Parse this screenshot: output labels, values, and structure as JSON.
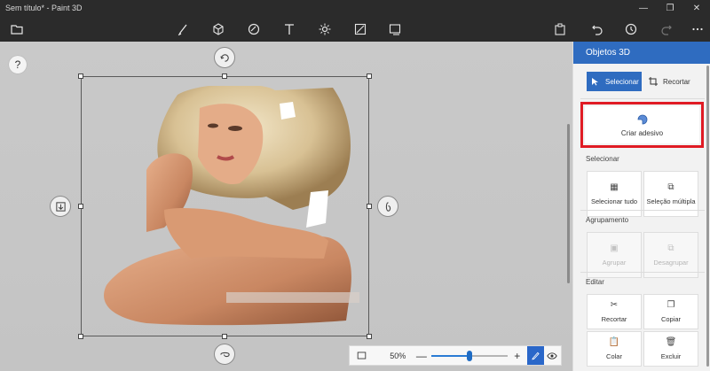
{
  "window": {
    "title": "Sem título* - Paint 3D"
  },
  "window_controls": {
    "minimize": "—",
    "maximize": "❐",
    "close": "✕"
  },
  "toolbar": {
    "tools": [
      "menu-icon",
      "brushes-icon",
      "3d-shapes-icon",
      "stickers-icon",
      "text-icon",
      "effects-icon",
      "canvas-icon",
      "3d-library-icon"
    ],
    "right": [
      "paste-icon",
      "undo-icon",
      "history-icon",
      "redo-icon",
      "more-icon"
    ]
  },
  "canvas": {
    "help_label": "?"
  },
  "zoom": {
    "percent_label": "50%",
    "minus_label": "—",
    "plus_label": "+",
    "level": 0.5
  },
  "panel": {
    "title": "Objetos 3D",
    "select_label": "Selecionar",
    "crop_label": "Recortar",
    "sticker_label": "Criar adesivo",
    "sections": {
      "select": {
        "label": "Selecionar",
        "all_label": "Selecionar tudo",
        "multi_label": "Seleção múltipla"
      },
      "group": {
        "label": "Agrupamento",
        "group_label": "Agrupar",
        "ungroup_label": "Desagrupar"
      },
      "edit": {
        "label": "Editar",
        "cut_label": "Recortar",
        "copy_label": "Copiar",
        "paste_label": "Colar",
        "delete_label": "Excluir"
      }
    }
  },
  "colors": {
    "accent": "#2f6cc0",
    "highlight_border": "#e01b24",
    "toolbar": "#2b2b2b"
  }
}
